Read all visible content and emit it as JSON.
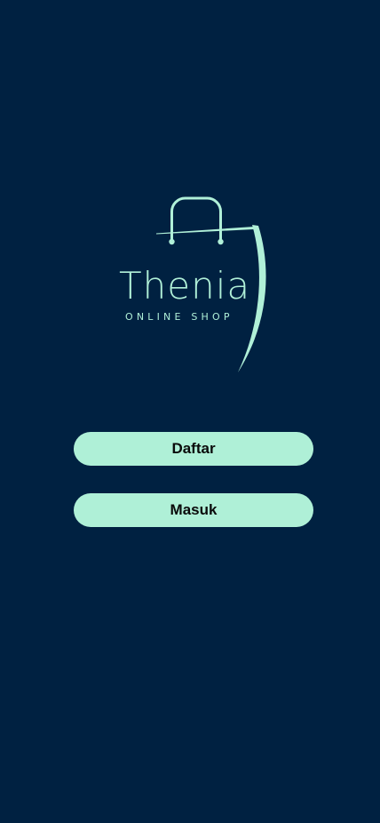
{
  "brand": {
    "name": "Thenia",
    "tagline": "ONLINE SHOP"
  },
  "actions": {
    "register_label": "Daftar",
    "login_label": "Masuk"
  },
  "colors": {
    "background": "#002141",
    "accent": "#aff0d7",
    "button_text": "#0a0a0a"
  }
}
